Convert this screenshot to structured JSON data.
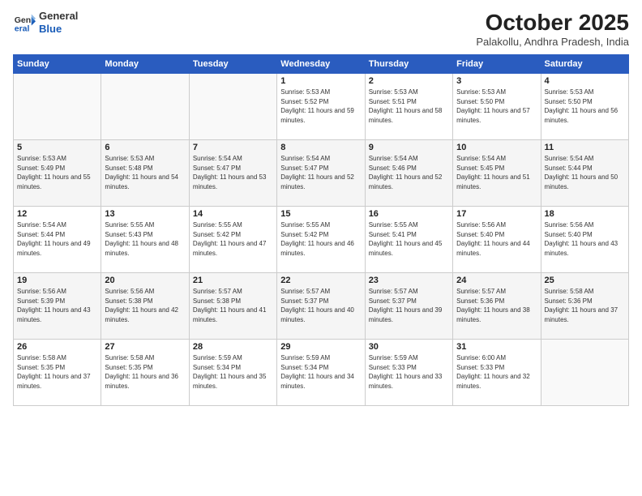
{
  "header": {
    "logo_line1": "General",
    "logo_line2": "Blue",
    "month": "October 2025",
    "location": "Palakollu, Andhra Pradesh, India"
  },
  "weekdays": [
    "Sunday",
    "Monday",
    "Tuesday",
    "Wednesday",
    "Thursday",
    "Friday",
    "Saturday"
  ],
  "weeks": [
    [
      {
        "day": "",
        "sunrise": "",
        "sunset": "",
        "daylight": ""
      },
      {
        "day": "",
        "sunrise": "",
        "sunset": "",
        "daylight": ""
      },
      {
        "day": "",
        "sunrise": "",
        "sunset": "",
        "daylight": ""
      },
      {
        "day": "1",
        "sunrise": "Sunrise: 5:53 AM",
        "sunset": "Sunset: 5:52 PM",
        "daylight": "Daylight: 11 hours and 59 minutes."
      },
      {
        "day": "2",
        "sunrise": "Sunrise: 5:53 AM",
        "sunset": "Sunset: 5:51 PM",
        "daylight": "Daylight: 11 hours and 58 minutes."
      },
      {
        "day": "3",
        "sunrise": "Sunrise: 5:53 AM",
        "sunset": "Sunset: 5:50 PM",
        "daylight": "Daylight: 11 hours and 57 minutes."
      },
      {
        "day": "4",
        "sunrise": "Sunrise: 5:53 AM",
        "sunset": "Sunset: 5:50 PM",
        "daylight": "Daylight: 11 hours and 56 minutes."
      }
    ],
    [
      {
        "day": "5",
        "sunrise": "Sunrise: 5:53 AM",
        "sunset": "Sunset: 5:49 PM",
        "daylight": "Daylight: 11 hours and 55 minutes."
      },
      {
        "day": "6",
        "sunrise": "Sunrise: 5:53 AM",
        "sunset": "Sunset: 5:48 PM",
        "daylight": "Daylight: 11 hours and 54 minutes."
      },
      {
        "day": "7",
        "sunrise": "Sunrise: 5:54 AM",
        "sunset": "Sunset: 5:47 PM",
        "daylight": "Daylight: 11 hours and 53 minutes."
      },
      {
        "day": "8",
        "sunrise": "Sunrise: 5:54 AM",
        "sunset": "Sunset: 5:47 PM",
        "daylight": "Daylight: 11 hours and 52 minutes."
      },
      {
        "day": "9",
        "sunrise": "Sunrise: 5:54 AM",
        "sunset": "Sunset: 5:46 PM",
        "daylight": "Daylight: 11 hours and 52 minutes."
      },
      {
        "day": "10",
        "sunrise": "Sunrise: 5:54 AM",
        "sunset": "Sunset: 5:45 PM",
        "daylight": "Daylight: 11 hours and 51 minutes."
      },
      {
        "day": "11",
        "sunrise": "Sunrise: 5:54 AM",
        "sunset": "Sunset: 5:44 PM",
        "daylight": "Daylight: 11 hours and 50 minutes."
      }
    ],
    [
      {
        "day": "12",
        "sunrise": "Sunrise: 5:54 AM",
        "sunset": "Sunset: 5:44 PM",
        "daylight": "Daylight: 11 hours and 49 minutes."
      },
      {
        "day": "13",
        "sunrise": "Sunrise: 5:55 AM",
        "sunset": "Sunset: 5:43 PM",
        "daylight": "Daylight: 11 hours and 48 minutes."
      },
      {
        "day": "14",
        "sunrise": "Sunrise: 5:55 AM",
        "sunset": "Sunset: 5:42 PM",
        "daylight": "Daylight: 11 hours and 47 minutes."
      },
      {
        "day": "15",
        "sunrise": "Sunrise: 5:55 AM",
        "sunset": "Sunset: 5:42 PM",
        "daylight": "Daylight: 11 hours and 46 minutes."
      },
      {
        "day": "16",
        "sunrise": "Sunrise: 5:55 AM",
        "sunset": "Sunset: 5:41 PM",
        "daylight": "Daylight: 11 hours and 45 minutes."
      },
      {
        "day": "17",
        "sunrise": "Sunrise: 5:56 AM",
        "sunset": "Sunset: 5:40 PM",
        "daylight": "Daylight: 11 hours and 44 minutes."
      },
      {
        "day": "18",
        "sunrise": "Sunrise: 5:56 AM",
        "sunset": "Sunset: 5:40 PM",
        "daylight": "Daylight: 11 hours and 43 minutes."
      }
    ],
    [
      {
        "day": "19",
        "sunrise": "Sunrise: 5:56 AM",
        "sunset": "Sunset: 5:39 PM",
        "daylight": "Daylight: 11 hours and 43 minutes."
      },
      {
        "day": "20",
        "sunrise": "Sunrise: 5:56 AM",
        "sunset": "Sunset: 5:38 PM",
        "daylight": "Daylight: 11 hours and 42 minutes."
      },
      {
        "day": "21",
        "sunrise": "Sunrise: 5:57 AM",
        "sunset": "Sunset: 5:38 PM",
        "daylight": "Daylight: 11 hours and 41 minutes."
      },
      {
        "day": "22",
        "sunrise": "Sunrise: 5:57 AM",
        "sunset": "Sunset: 5:37 PM",
        "daylight": "Daylight: 11 hours and 40 minutes."
      },
      {
        "day": "23",
        "sunrise": "Sunrise: 5:57 AM",
        "sunset": "Sunset: 5:37 PM",
        "daylight": "Daylight: 11 hours and 39 minutes."
      },
      {
        "day": "24",
        "sunrise": "Sunrise: 5:57 AM",
        "sunset": "Sunset: 5:36 PM",
        "daylight": "Daylight: 11 hours and 38 minutes."
      },
      {
        "day": "25",
        "sunrise": "Sunrise: 5:58 AM",
        "sunset": "Sunset: 5:36 PM",
        "daylight": "Daylight: 11 hours and 37 minutes."
      }
    ],
    [
      {
        "day": "26",
        "sunrise": "Sunrise: 5:58 AM",
        "sunset": "Sunset: 5:35 PM",
        "daylight": "Daylight: 11 hours and 37 minutes."
      },
      {
        "day": "27",
        "sunrise": "Sunrise: 5:58 AM",
        "sunset": "Sunset: 5:35 PM",
        "daylight": "Daylight: 11 hours and 36 minutes."
      },
      {
        "day": "28",
        "sunrise": "Sunrise: 5:59 AM",
        "sunset": "Sunset: 5:34 PM",
        "daylight": "Daylight: 11 hours and 35 minutes."
      },
      {
        "day": "29",
        "sunrise": "Sunrise: 5:59 AM",
        "sunset": "Sunset: 5:34 PM",
        "daylight": "Daylight: 11 hours and 34 minutes."
      },
      {
        "day": "30",
        "sunrise": "Sunrise: 5:59 AM",
        "sunset": "Sunset: 5:33 PM",
        "daylight": "Daylight: 11 hours and 33 minutes."
      },
      {
        "day": "31",
        "sunrise": "Sunrise: 6:00 AM",
        "sunset": "Sunset: 5:33 PM",
        "daylight": "Daylight: 11 hours and 32 minutes."
      },
      {
        "day": "",
        "sunrise": "",
        "sunset": "",
        "daylight": ""
      }
    ]
  ]
}
